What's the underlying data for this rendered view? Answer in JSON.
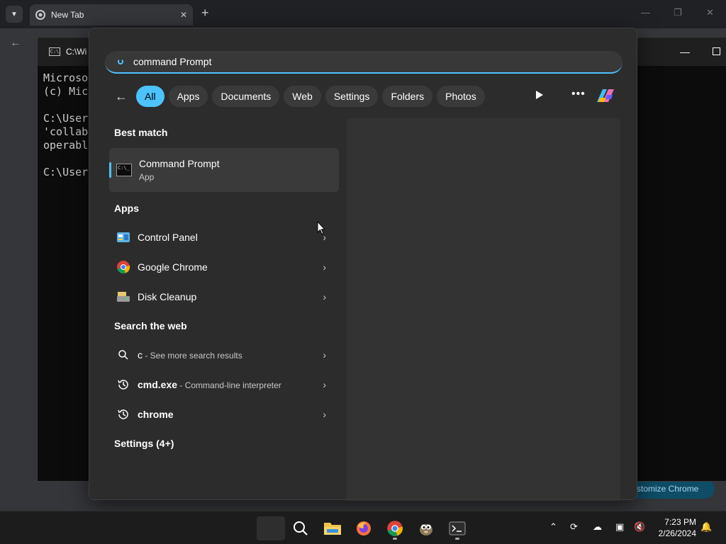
{
  "browser": {
    "tab_title": "New Tab",
    "customize_label": "Customize Chrome",
    "customize_visible": "stomize Chrome"
  },
  "console": {
    "tab_title": "C:\\Wi",
    "lines": "Microso\n(c) Mic\n\nC:\\Users\n'collab\noperabl\n\nC:\\Users"
  },
  "search": {
    "query": "command Prompt",
    "filters": [
      "All",
      "Apps",
      "Documents",
      "Web",
      "Settings",
      "Folders",
      "Photos"
    ],
    "best_match_title": "Best match",
    "best_match": {
      "name": "Command Prompt",
      "type": "App"
    },
    "apps_title": "Apps",
    "apps": [
      {
        "name": "Control Panel",
        "icon": "control-panel-icon"
      },
      {
        "name": "Google Chrome",
        "icon": "chrome-icon"
      },
      {
        "name": "Disk Cleanup",
        "icon": "disk-cleanup-icon"
      }
    ],
    "web_title": "Search the web",
    "web": [
      {
        "name": "c",
        "sub": " - See more search results",
        "icon": "search-icon"
      },
      {
        "name": "cmd.exe",
        "sub": " - Command-line interpreter",
        "icon": "history-icon"
      },
      {
        "name": "chrome",
        "sub": "",
        "icon": "history-icon"
      }
    ],
    "settings_title": "Settings (4+)"
  },
  "taskbar": {
    "time": "7:23 PM",
    "date": "2/26/2024"
  },
  "colors": {
    "accent": "#4cc2ff",
    "panel": "#2c2c2c"
  }
}
